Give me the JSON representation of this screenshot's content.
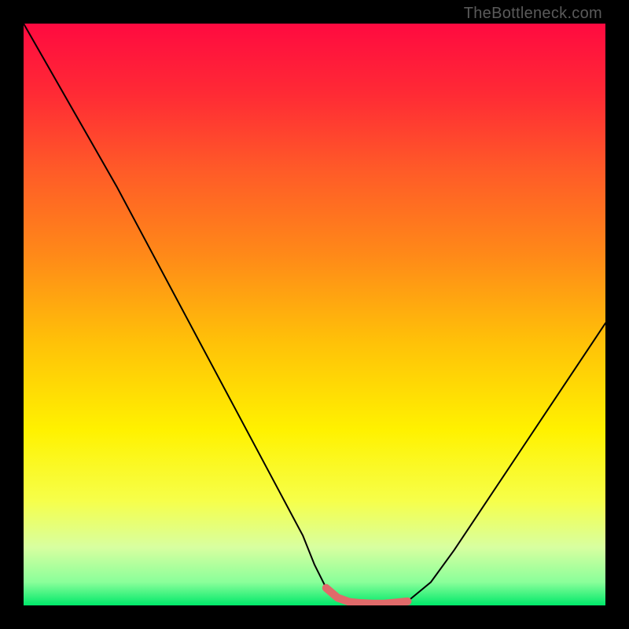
{
  "watermark": "TheBottleneck.com",
  "chart_data": {
    "type": "line",
    "title": "",
    "xlabel": "",
    "ylabel": "",
    "xlim": [
      0,
      100
    ],
    "ylim": [
      0,
      100
    ],
    "gradient_stops": [
      {
        "pos": 0.0,
        "color": "#ff0a40"
      },
      {
        "pos": 0.12,
        "color": "#ff2a35"
      },
      {
        "pos": 0.25,
        "color": "#ff5a28"
      },
      {
        "pos": 0.4,
        "color": "#ff8a18"
      },
      {
        "pos": 0.55,
        "color": "#ffc208"
      },
      {
        "pos": 0.7,
        "color": "#fff200"
      },
      {
        "pos": 0.82,
        "color": "#f6ff4a"
      },
      {
        "pos": 0.9,
        "color": "#d8ffa0"
      },
      {
        "pos": 0.96,
        "color": "#8aff9a"
      },
      {
        "pos": 1.0,
        "color": "#00e86a"
      }
    ],
    "series": [
      {
        "name": "bottleneck-curve",
        "color": "#000000",
        "width": 2,
        "x": [
          0.0,
          4.0,
          8.0,
          12.0,
          16.0,
          20.0,
          24.0,
          28.0,
          32.0,
          36.0,
          40.0,
          44.0,
          48.0,
          50.0,
          52.0,
          56.0,
          60.0,
          63.0,
          66.0,
          70.0,
          74.0,
          78.0,
          82.0,
          86.0,
          90.0,
          94.0,
          98.0,
          100.0
        ],
        "values": [
          100.0,
          93.0,
          86.0,
          79.0,
          72.0,
          64.5,
          57.0,
          49.5,
          42.0,
          34.5,
          27.0,
          19.5,
          12.0,
          7.0,
          3.0,
          0.6,
          0.3,
          0.3,
          0.7,
          4.0,
          9.5,
          15.5,
          21.5,
          27.5,
          33.5,
          39.5,
          45.5,
          48.5
        ]
      },
      {
        "name": "optimal-region",
        "color": "#e06a6a",
        "width": 10,
        "linecap": "round",
        "x": [
          52.0,
          54.0,
          56.0,
          58.0,
          60.0,
          62.0,
          64.0,
          66.0
        ],
        "values": [
          3.0,
          1.3,
          0.6,
          0.4,
          0.3,
          0.3,
          0.5,
          0.7
        ]
      }
    ]
  }
}
